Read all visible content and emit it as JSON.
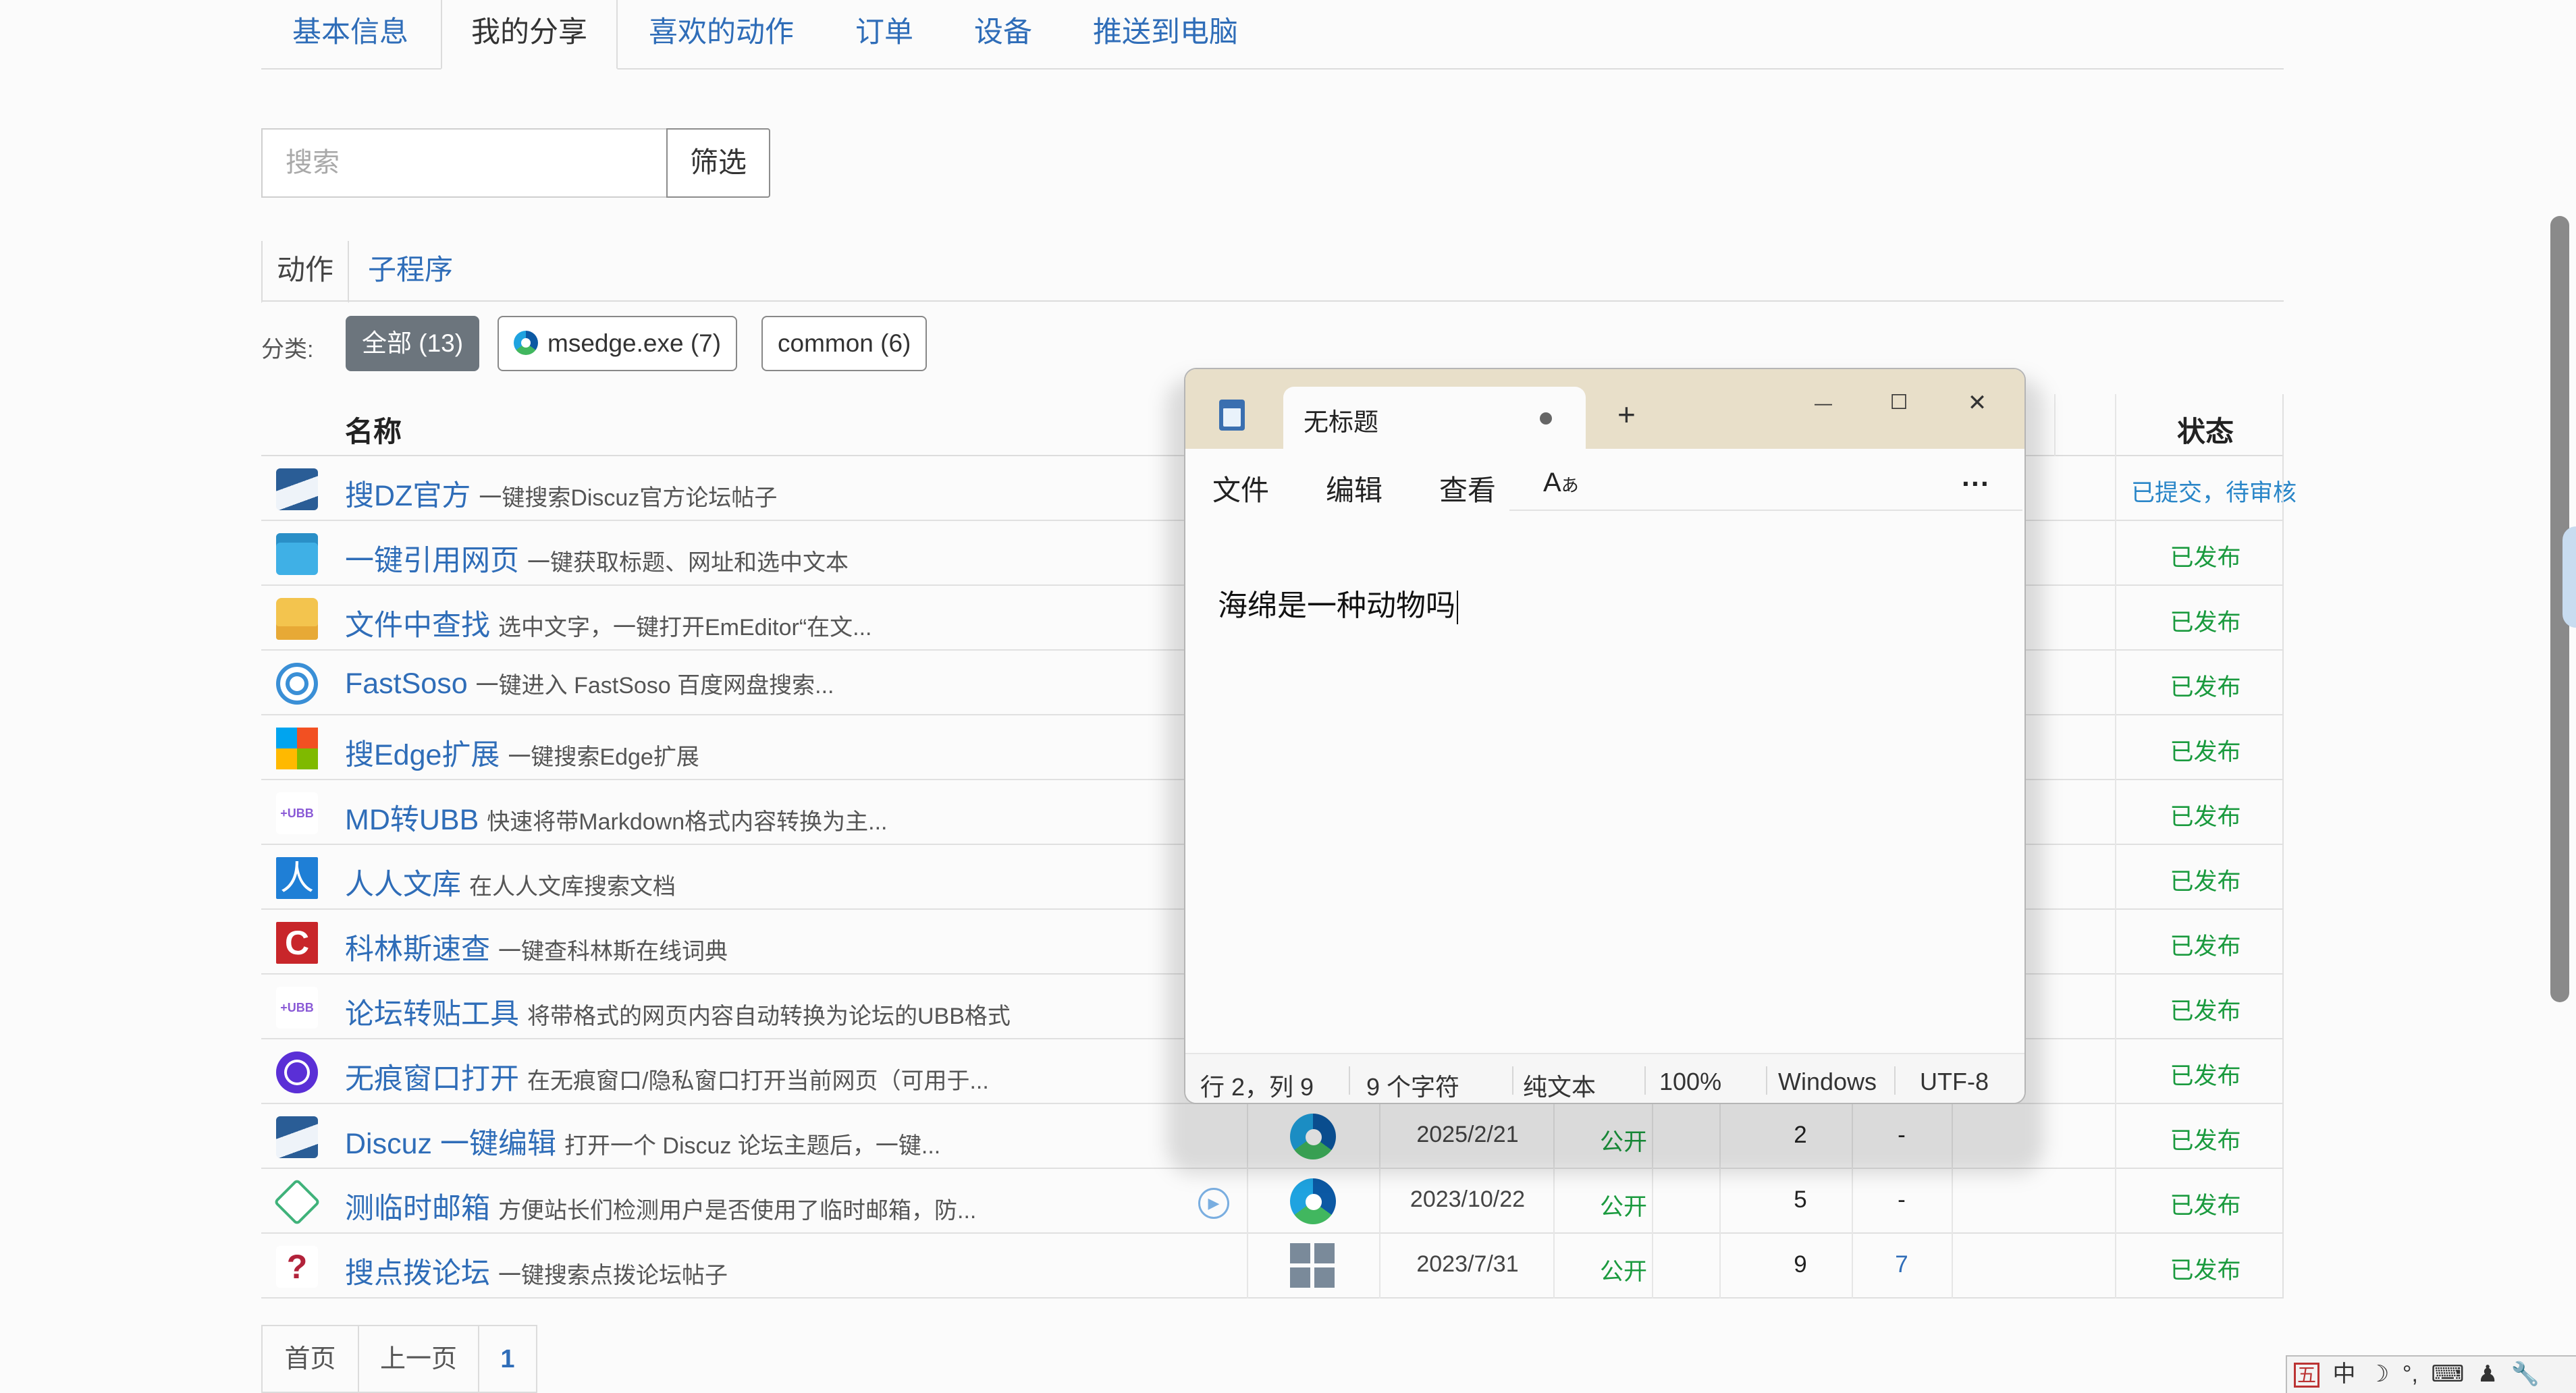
{
  "top_tabs": [
    {
      "label": "基本信息",
      "active": false
    },
    {
      "label": "我的分享",
      "active": true
    },
    {
      "label": "喜欢的动作",
      "active": false
    },
    {
      "label": "订单",
      "active": false
    },
    {
      "label": "设备",
      "active": false
    },
    {
      "label": "推送到电脑",
      "active": false
    }
  ],
  "search": {
    "placeholder": "搜索",
    "filter_label": "筛选"
  },
  "sub_tabs": [
    {
      "label": "动作",
      "active": true
    },
    {
      "label": "子程序",
      "active": false
    }
  ],
  "category": {
    "label": "分类:",
    "chips": [
      {
        "label": "全部 (13)",
        "active": true
      },
      {
        "label": "msedge.exe (7)",
        "active": false,
        "icon": "edge-icon"
      },
      {
        "label": "common (6)",
        "active": false
      }
    ]
  },
  "table": {
    "headers": {
      "name": "名称",
      "status": "状态"
    },
    "rows": [
      {
        "title": "搜DZ官方",
        "desc": "一键搜索Discuz官方论坛帖子",
        "status": "已提交，待审核",
        "icon": "discuz-icon"
      },
      {
        "title": "一键引用网页",
        "desc": "一键获取标题、网址和选中文本",
        "status": "已发布",
        "icon": "quote-icon"
      },
      {
        "title": "文件中查找",
        "desc": "选中文字，一键打开EmEditor“在文...",
        "status": "已发布",
        "icon": "folder-search-icon"
      },
      {
        "title": "FastSoso",
        "desc": "一键进入 FastSoso 百度网盘搜索...",
        "status": "已发布",
        "icon": "fastsoso-icon"
      },
      {
        "title": "搜Edge扩展",
        "desc": "一键搜索Edge扩展",
        "status": "已发布",
        "icon": "windows-icon"
      },
      {
        "title": "MD转UBB",
        "desc": "快速将带Markdown格式内容转换为主...",
        "status": "已发布",
        "icon": "ubb-icon"
      },
      {
        "title": "人人文库",
        "desc": "在人人文库搜索文档",
        "status": "已发布",
        "icon": "renren-icon"
      },
      {
        "title": "科林斯速查",
        "desc": "一键查科林斯在线词典",
        "status": "已发布",
        "icon": "collins-icon"
      },
      {
        "title": "论坛转贴工具",
        "desc": "将带格式的网页内容自动转换为论坛的UBB格式",
        "status": "已发布",
        "icon": "ubb-icon"
      },
      {
        "title": "无痕窗口打开",
        "desc": "在无痕窗口/隐私窗口打开当前网页（可用于...",
        "status": "已发布",
        "icon": "incognito-icon"
      },
      {
        "title": "Discuz 一键编辑",
        "desc": "打开一个 Discuz 论坛主题后，一键...",
        "status": "已发布",
        "icon": "discuz-icon",
        "platform": "edge-icon",
        "date": "2025/2/21",
        "visibility": "公开",
        "count": "2",
        "extra": "-"
      },
      {
        "title": "测临时邮箱",
        "desc": "方便站长们检测用户是否使用了临时邮箱，防...",
        "status": "已发布",
        "icon": "mail-check-icon",
        "platform": "edge-icon",
        "date": "2023/10/22",
        "visibility": "公开",
        "count": "5",
        "extra": "-",
        "has_play": true
      },
      {
        "title": "搜点拨论坛",
        "desc": "一键搜索点拨论坛帖子",
        "status": "已发布",
        "icon": "dianbo-icon",
        "platform": "grid-icon",
        "date": "2023/7/31",
        "visibility": "公开",
        "count": "9",
        "extra": "7"
      }
    ]
  },
  "pagination": {
    "first": "首页",
    "prev": "上一页",
    "current": "1"
  },
  "notepad": {
    "tab_title": "无标题",
    "new_tab": "+",
    "controls": {
      "minimize": "—",
      "maximize": "☐",
      "close": "✕"
    },
    "menu": {
      "file": "文件",
      "edit": "编辑",
      "view": "查看",
      "more": "···"
    },
    "content": "海绵是一种动物吗",
    "status": {
      "position": "行 2，列 9",
      "chars": "9 个字符",
      "format": "纯文本",
      "zoom": "100%",
      "eol": "Windows",
      "encoding": "UTF-8"
    }
  },
  "tray": {
    "items": [
      "五",
      "中",
      "☽",
      "°,",
      "⌨",
      "♟",
      "🔧"
    ]
  },
  "colors": {
    "link": "#2f6db8",
    "published": "#1a9a3e",
    "pending": "#2a86c8",
    "notepad_titlebar": "#e8dfc9"
  }
}
